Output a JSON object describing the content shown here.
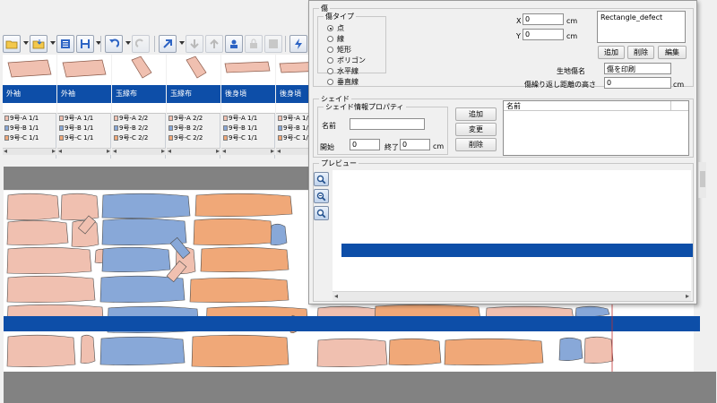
{
  "piece_names": [
    "外袖",
    "外袖",
    "玉縁布",
    "玉縁布",
    "後身頃",
    "後身頃"
  ],
  "piece_sizes": [
    [
      {
        "label": "9号-A 1/1",
        "color": "#f0c0b0"
      },
      {
        "label": "9号-B 1/1",
        "color": "#88a8d8"
      },
      {
        "label": "9号-C 1/1",
        "color": "#f0a878"
      }
    ],
    [
      {
        "label": "9号-A 1/1",
        "color": "#f0c0b0"
      },
      {
        "label": "9号-B 1/1",
        "color": "#88a8d8"
      },
      {
        "label": "9号-C 1/1",
        "color": "#f0a878"
      }
    ],
    [
      {
        "label": "9号-A 2/2",
        "color": "#f0c0b0"
      },
      {
        "label": "9号-B 2/2",
        "color": "#88a8d8"
      },
      {
        "label": "9号-C 2/2",
        "color": "#f0a878"
      }
    ],
    [
      {
        "label": "9号-A 2/2",
        "color": "#f0c0b0"
      },
      {
        "label": "9号-B 2/2",
        "color": "#88a8d8"
      },
      {
        "label": "9号-C 2/2",
        "color": "#f0a878"
      }
    ],
    [
      {
        "label": "9号-A 1/1",
        "color": "#f0c0b0"
      },
      {
        "label": "9号-B 1/1",
        "color": "#88a8d8"
      },
      {
        "label": "9号-C 1/1",
        "color": "#f0a878"
      }
    ],
    [
      {
        "label": "9号-A 1/1",
        "color": "#f0c0b0"
      },
      {
        "label": "9号-B 1/1",
        "color": "#88a8d8"
      },
      {
        "label": "9号-C 1/1",
        "color": "#f0a878"
      }
    ]
  ],
  "colors": {
    "size_a": "#f0c0b0",
    "size_b": "#88a8d8",
    "size_c": "#f0a878",
    "header_blue": "#0d4ea8"
  },
  "dialog": {
    "defect_group": "傷",
    "defect_type_group": "傷タイプ",
    "defect_types": [
      "点",
      "線",
      "矩形",
      "ポリゴン",
      "水平線",
      "垂直線"
    ],
    "defect_type_selected": 0,
    "x_label": "X",
    "x_value": "0",
    "x_unit": "cm",
    "y_label": "Y",
    "y_value": "0",
    "y_unit": "cm",
    "defect_list": [
      "Rectangle_defect"
    ],
    "add_label": "追加",
    "delete_label": "削除",
    "edit_label": "編集",
    "fabric_defect_name_label": "生地傷名",
    "fabric_defect_name_value": "傷を印刷",
    "repeat_height_label": "傷繰り返し距離の高さ",
    "repeat_height_value": "0",
    "repeat_height_unit": "cm",
    "shade_group": "シェイド",
    "shade_props_group": "シェイド情報プロパティ",
    "shade_name_label": "名前",
    "start_label": "開始",
    "start_value": "0",
    "end_label": "終了",
    "end_value": "0",
    "end_unit": "cm",
    "shade_add_label": "追加",
    "shade_change_label": "変更",
    "shade_delete_label": "削除",
    "shade_list_header": "名前",
    "preview_group": "プレビュー"
  }
}
